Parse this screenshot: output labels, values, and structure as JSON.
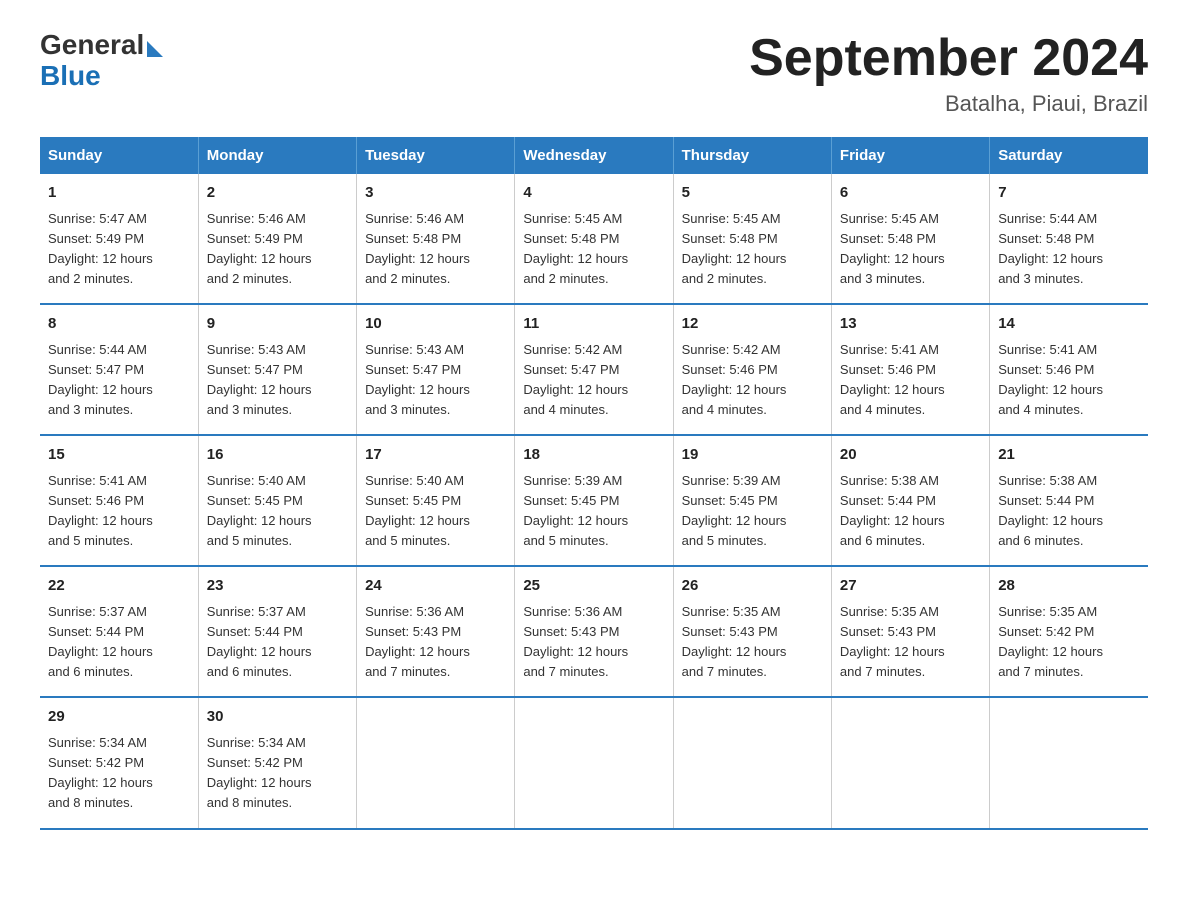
{
  "header": {
    "logo_general": "General",
    "logo_blue": "Blue",
    "title": "September 2024",
    "subtitle": "Batalha, Piaui, Brazil"
  },
  "days_of_week": [
    "Sunday",
    "Monday",
    "Tuesday",
    "Wednesday",
    "Thursday",
    "Friday",
    "Saturday"
  ],
  "weeks": [
    [
      {
        "day": "1",
        "info": "Sunrise: 5:47 AM\nSunset: 5:49 PM\nDaylight: 12 hours\nand 2 minutes."
      },
      {
        "day": "2",
        "info": "Sunrise: 5:46 AM\nSunset: 5:49 PM\nDaylight: 12 hours\nand 2 minutes."
      },
      {
        "day": "3",
        "info": "Sunrise: 5:46 AM\nSunset: 5:48 PM\nDaylight: 12 hours\nand 2 minutes."
      },
      {
        "day": "4",
        "info": "Sunrise: 5:45 AM\nSunset: 5:48 PM\nDaylight: 12 hours\nand 2 minutes."
      },
      {
        "day": "5",
        "info": "Sunrise: 5:45 AM\nSunset: 5:48 PM\nDaylight: 12 hours\nand 2 minutes."
      },
      {
        "day": "6",
        "info": "Sunrise: 5:45 AM\nSunset: 5:48 PM\nDaylight: 12 hours\nand 3 minutes."
      },
      {
        "day": "7",
        "info": "Sunrise: 5:44 AM\nSunset: 5:48 PM\nDaylight: 12 hours\nand 3 minutes."
      }
    ],
    [
      {
        "day": "8",
        "info": "Sunrise: 5:44 AM\nSunset: 5:47 PM\nDaylight: 12 hours\nand 3 minutes."
      },
      {
        "day": "9",
        "info": "Sunrise: 5:43 AM\nSunset: 5:47 PM\nDaylight: 12 hours\nand 3 minutes."
      },
      {
        "day": "10",
        "info": "Sunrise: 5:43 AM\nSunset: 5:47 PM\nDaylight: 12 hours\nand 3 minutes."
      },
      {
        "day": "11",
        "info": "Sunrise: 5:42 AM\nSunset: 5:47 PM\nDaylight: 12 hours\nand 4 minutes."
      },
      {
        "day": "12",
        "info": "Sunrise: 5:42 AM\nSunset: 5:46 PM\nDaylight: 12 hours\nand 4 minutes."
      },
      {
        "day": "13",
        "info": "Sunrise: 5:41 AM\nSunset: 5:46 PM\nDaylight: 12 hours\nand 4 minutes."
      },
      {
        "day": "14",
        "info": "Sunrise: 5:41 AM\nSunset: 5:46 PM\nDaylight: 12 hours\nand 4 minutes."
      }
    ],
    [
      {
        "day": "15",
        "info": "Sunrise: 5:41 AM\nSunset: 5:46 PM\nDaylight: 12 hours\nand 5 minutes."
      },
      {
        "day": "16",
        "info": "Sunrise: 5:40 AM\nSunset: 5:45 PM\nDaylight: 12 hours\nand 5 minutes."
      },
      {
        "day": "17",
        "info": "Sunrise: 5:40 AM\nSunset: 5:45 PM\nDaylight: 12 hours\nand 5 minutes."
      },
      {
        "day": "18",
        "info": "Sunrise: 5:39 AM\nSunset: 5:45 PM\nDaylight: 12 hours\nand 5 minutes."
      },
      {
        "day": "19",
        "info": "Sunrise: 5:39 AM\nSunset: 5:45 PM\nDaylight: 12 hours\nand 5 minutes."
      },
      {
        "day": "20",
        "info": "Sunrise: 5:38 AM\nSunset: 5:44 PM\nDaylight: 12 hours\nand 6 minutes."
      },
      {
        "day": "21",
        "info": "Sunrise: 5:38 AM\nSunset: 5:44 PM\nDaylight: 12 hours\nand 6 minutes."
      }
    ],
    [
      {
        "day": "22",
        "info": "Sunrise: 5:37 AM\nSunset: 5:44 PM\nDaylight: 12 hours\nand 6 minutes."
      },
      {
        "day": "23",
        "info": "Sunrise: 5:37 AM\nSunset: 5:44 PM\nDaylight: 12 hours\nand 6 minutes."
      },
      {
        "day": "24",
        "info": "Sunrise: 5:36 AM\nSunset: 5:43 PM\nDaylight: 12 hours\nand 7 minutes."
      },
      {
        "day": "25",
        "info": "Sunrise: 5:36 AM\nSunset: 5:43 PM\nDaylight: 12 hours\nand 7 minutes."
      },
      {
        "day": "26",
        "info": "Sunrise: 5:35 AM\nSunset: 5:43 PM\nDaylight: 12 hours\nand 7 minutes."
      },
      {
        "day": "27",
        "info": "Sunrise: 5:35 AM\nSunset: 5:43 PM\nDaylight: 12 hours\nand 7 minutes."
      },
      {
        "day": "28",
        "info": "Sunrise: 5:35 AM\nSunset: 5:42 PM\nDaylight: 12 hours\nand 7 minutes."
      }
    ],
    [
      {
        "day": "29",
        "info": "Sunrise: 5:34 AM\nSunset: 5:42 PM\nDaylight: 12 hours\nand 8 minutes."
      },
      {
        "day": "30",
        "info": "Sunrise: 5:34 AM\nSunset: 5:42 PM\nDaylight: 12 hours\nand 8 minutes."
      },
      {
        "day": "",
        "info": ""
      },
      {
        "day": "",
        "info": ""
      },
      {
        "day": "",
        "info": ""
      },
      {
        "day": "",
        "info": ""
      },
      {
        "day": "",
        "info": ""
      }
    ]
  ]
}
